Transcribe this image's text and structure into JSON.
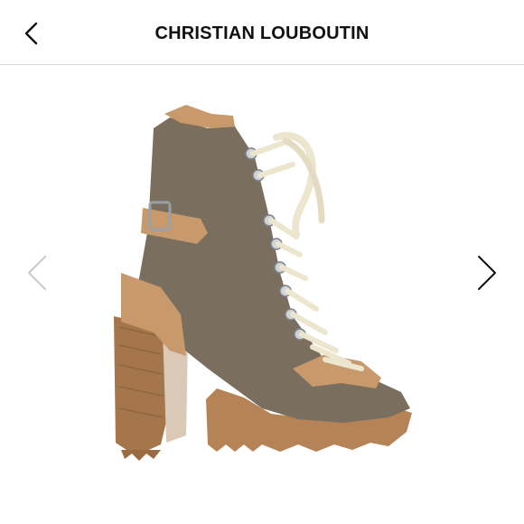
{
  "header": {
    "title": "CHRISTIAN LOUBOUTIN",
    "back_icon": "chevron-left-icon"
  },
  "gallery": {
    "image_subject": "boot",
    "prev_icon": "chevron-left-icon",
    "next_icon": "chevron-right-icon"
  },
  "colors": {
    "suede": "#7a6e5f",
    "leather_trim": "#c89a6b",
    "heel_wood": "#a5754c",
    "laces": "#ede6cf",
    "sole": "#b58356"
  }
}
